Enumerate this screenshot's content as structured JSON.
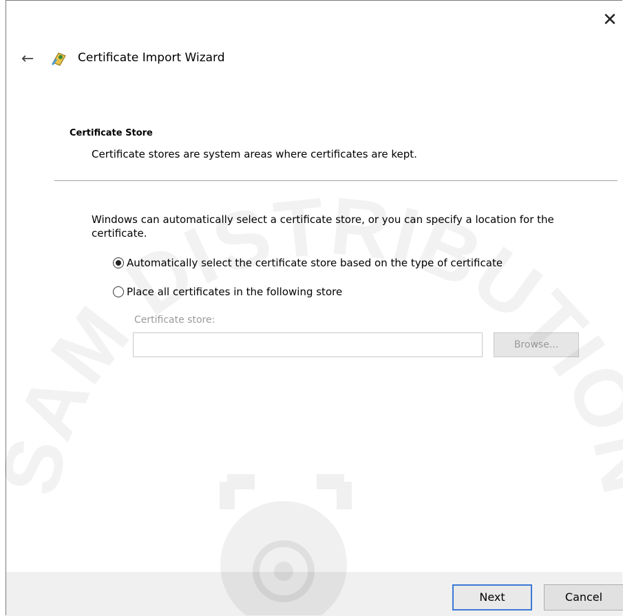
{
  "window": {
    "close_glyph": "✕",
    "back_glyph": "←",
    "title": "Certificate Import Wizard"
  },
  "section": {
    "title": "Certificate Store",
    "description": "Certificate stores are system areas where certificates are kept."
  },
  "intro": "Windows can automatically select a certificate store, or you can specify a location for the certificate.",
  "options": [
    {
      "label": "Automatically select the certificate store based on the type of certificate",
      "selected": true
    },
    {
      "label": "Place all certificates in the following store",
      "selected": false
    }
  ],
  "store": {
    "label": "Certificate store:",
    "value": "",
    "browse_label": "Browse..."
  },
  "footer": {
    "next_label": "Next",
    "cancel_label": "Cancel"
  },
  "watermark": {
    "text": "SAM DISTRIBUTION"
  },
  "colors": {
    "accent_border": "#3a78d4",
    "disabled_text": "#9a9a9a",
    "footer_bg": "#f0f0f0"
  }
}
